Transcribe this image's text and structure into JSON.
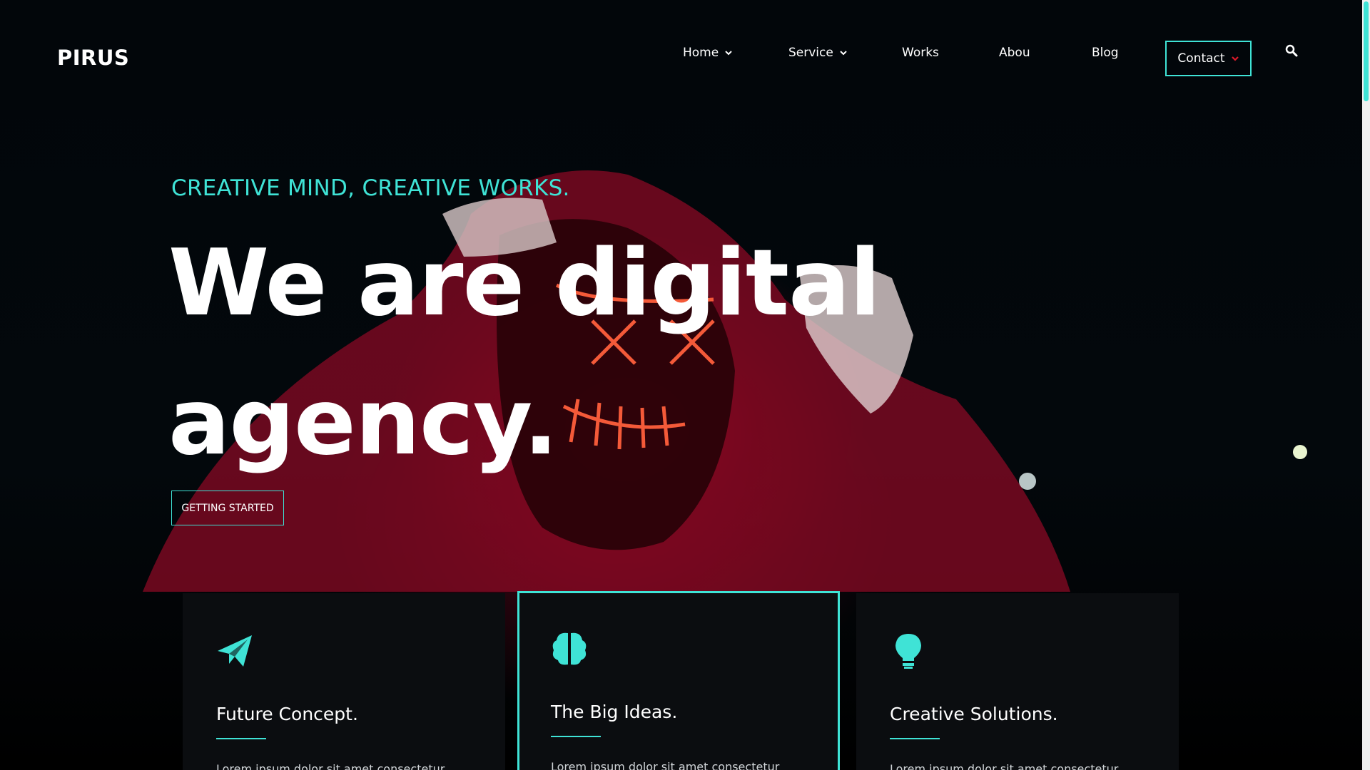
{
  "brand": {
    "logo": "PIRUS"
  },
  "nav": {
    "items": [
      {
        "label": "Home",
        "has_dropdown": true
      },
      {
        "label": "Service",
        "has_dropdown": true
      },
      {
        "label": "Works",
        "has_dropdown": false
      },
      {
        "label": "Abou",
        "has_dropdown": false
      },
      {
        "label": "Blog",
        "has_dropdown": false
      }
    ],
    "contact_label": "Contact",
    "search_icon": "search-icon"
  },
  "hero": {
    "tagline": "CREATIVE MIND, CREATIVE WORKS.",
    "headline_line1": "We are digital",
    "headline_line2": "agency.",
    "cta_label": "GETTING STARTED"
  },
  "features": [
    {
      "icon": "paper-plane-icon",
      "title": "Future Concept.",
      "body": "Lorem ipsum dolor sit amet consectetur"
    },
    {
      "icon": "brain-icon",
      "title": "The Big Ideas.",
      "body": "Lorem ipsum dolor sit amet consectetur"
    },
    {
      "icon": "lightbulb-icon",
      "title": "Creative Solutions.",
      "body": "Lorem ipsum dolor sit amet consectetur"
    }
  ],
  "colors": {
    "accent": "#3fe3d6",
    "background": "#000000",
    "card": "#0b0d10",
    "contact_chevron": "#e0192a"
  }
}
